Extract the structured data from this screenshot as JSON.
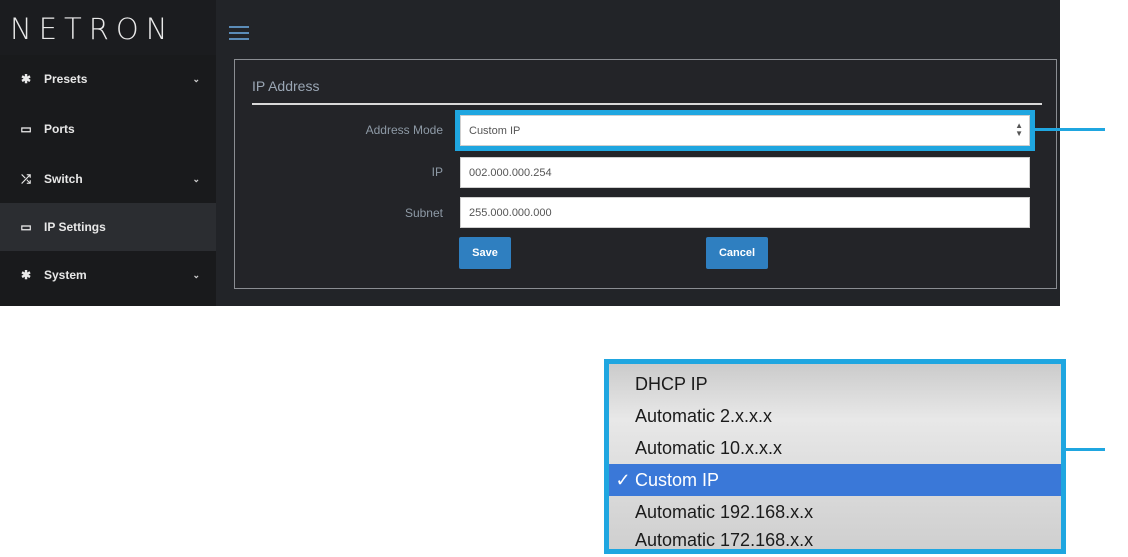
{
  "app": {
    "logo": "NETRON",
    "colors": {
      "accent": "#1fa6e0",
      "button": "#2f7fc0",
      "sidebar": "#191a1c",
      "background": "#222428"
    }
  },
  "sidebar": {
    "items": [
      {
        "label": "Presets",
        "icon": "gear-icon",
        "chevron": "⌄"
      },
      {
        "label": "Ports",
        "icon": "monitor-icon",
        "chevron": ""
      },
      {
        "label": "Switch",
        "icon": "shuffle-icon",
        "chevron": "⌄"
      },
      {
        "label": "IP Settings",
        "icon": "monitor-icon",
        "chevron": ""
      },
      {
        "label": "System",
        "icon": "gear-icon",
        "chevron": "⌄"
      }
    ],
    "active": "IP Settings"
  },
  "panel": {
    "title": "IP Address",
    "fields": {
      "mode_label": "Address Mode",
      "mode_value": "Custom IP",
      "ip_label": "IP",
      "ip_value": "002.000.000.254",
      "subnet_label": "Subnet",
      "subnet_value": "255.000.000.000"
    },
    "save_label": "Save",
    "cancel_label": "Cancel"
  },
  "dropdown": {
    "options": [
      {
        "label": "DHCP IP",
        "check": ""
      },
      {
        "label": "Automatic 2.x.x.x",
        "check": ""
      },
      {
        "label": "Automatic 10.x.x.x",
        "check": ""
      },
      {
        "label": "Custom IP",
        "check": "✓"
      },
      {
        "label": "Automatic 192.168.x.x",
        "check": ""
      },
      {
        "label": "Automatic 172.168.x.x",
        "check": ""
      }
    ],
    "selected": "Custom IP"
  }
}
